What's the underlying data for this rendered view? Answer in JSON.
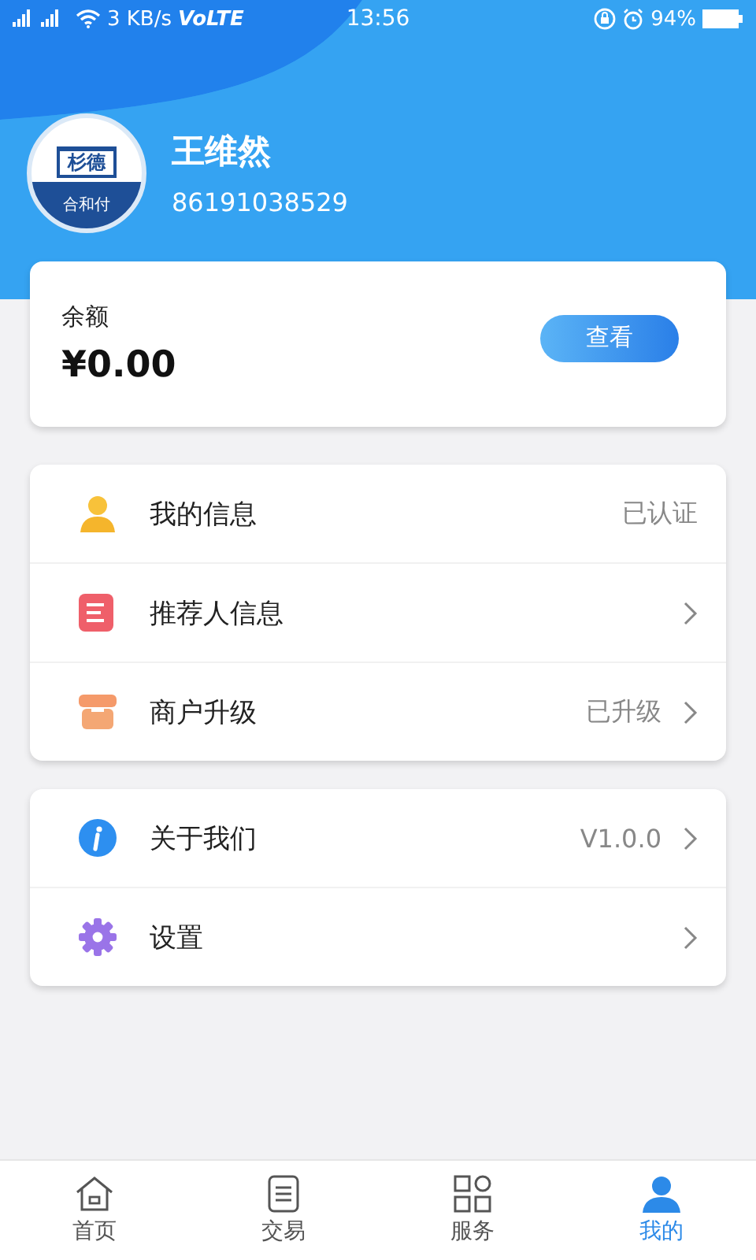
{
  "status_bar": {
    "speed": "3 KB/s",
    "network": "VoLTE",
    "time": "13:56",
    "battery": "94%"
  },
  "profile": {
    "logo_text": "杉德",
    "logo_caption": "合和付",
    "name": "王维然",
    "phone": "86191038529"
  },
  "balance": {
    "label": "余额",
    "amount": "¥0.00",
    "button": "查看"
  },
  "menu_groups": [
    {
      "items": [
        {
          "kind": "person",
          "label": "我的信息",
          "value": "已认证",
          "arrow": false
        },
        {
          "kind": "list",
          "label": "推荐人信息",
          "arrow": true
        },
        {
          "kind": "store",
          "label": "商户升级",
          "value": "已升级",
          "arrow": true
        }
      ]
    },
    {
      "items": [
        {
          "kind": "info",
          "label": "关于我们",
          "value": "V1.0.0",
          "arrow": true
        },
        {
          "kind": "gear",
          "label": "设置",
          "arrow": true
        }
      ]
    }
  ],
  "tabs": [
    {
      "kind": "home",
      "label": "首页",
      "selected": false
    },
    {
      "kind": "doc",
      "label": "交易",
      "selected": false
    },
    {
      "kind": "grid",
      "label": "服务",
      "selected": false
    },
    {
      "kind": "user",
      "label": "我的",
      "selected": true
    }
  ]
}
